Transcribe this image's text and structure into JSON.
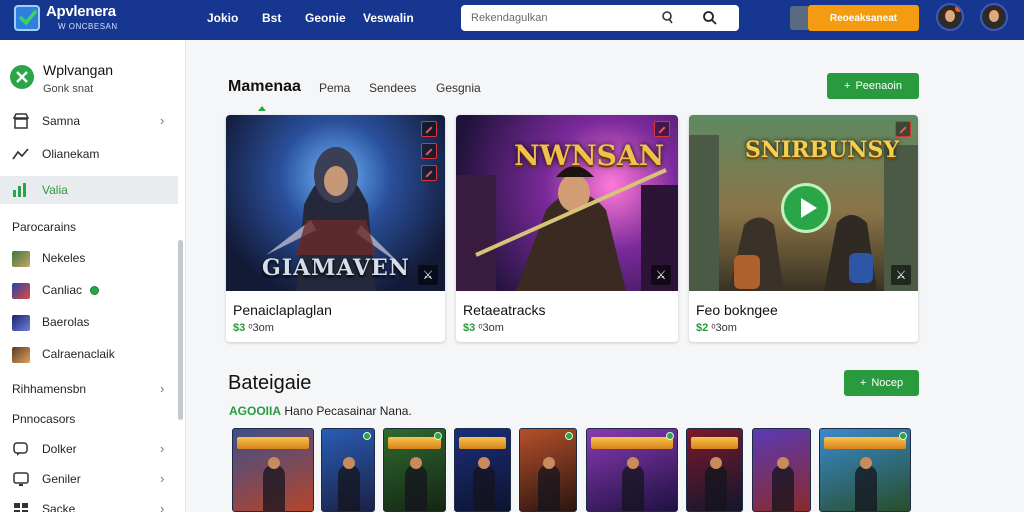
{
  "app": {
    "brand_title": "Apvlenera",
    "brand_sub": "W ONCBESAN"
  },
  "topbar": {
    "nav": [
      "Jokio",
      "Bst",
      "Geonie",
      "Veswalin"
    ],
    "search_placeholder": "Rekendagulkan",
    "cta_label": "Reoeaksaneat"
  },
  "sidebar": {
    "profile_name": "Wplvangan",
    "profile_sub": "Gonk snat",
    "nav_items": [
      {
        "label": "Samna",
        "icon": "store-icon",
        "chevron": "›"
      },
      {
        "label": "Olianekam",
        "icon": "trending-icon"
      },
      {
        "label": "Valia",
        "icon": "chart-icon",
        "active": true
      }
    ],
    "section1_heading": "Parocarains",
    "section1_items": [
      {
        "label": "Nekeles"
      },
      {
        "label": "Canliac",
        "badge": true
      },
      {
        "label": "Baerolas"
      },
      {
        "label": "Calraenaclaik"
      }
    ],
    "more_link": "Rihhamensbn",
    "more_chevron": "›",
    "section2_heading": "Pnnocasors",
    "section2_items": [
      {
        "label": "Dolker",
        "icon": "chat-icon",
        "chevron": "›"
      },
      {
        "label": "Geniler",
        "icon": "monitor-icon",
        "chevron": "›"
      },
      {
        "label": "Sacke",
        "icon": "grid-icon",
        "chevron": "›"
      }
    ]
  },
  "main": {
    "section_title": "Mamenaa",
    "tabs": [
      "Pema",
      "Sendees",
      "Gesgnia"
    ],
    "add_button_label": "Peenaoin",
    "add_button_icon": "+",
    "cards": [
      {
        "title": "Penaiclaplaglan",
        "price": "$3",
        "price_note": "ᵒ3om",
        "art_text": "GIAMAVEN"
      },
      {
        "title": "Retaeatracks",
        "price": "$3",
        "price_note": "ᵒ3om",
        "art_text": "NWNSAN"
      },
      {
        "title": "Feo bokngee",
        "price": "$2",
        "price_note": "ᵒ3om",
        "art_text": "SNIRBUNSY"
      }
    ],
    "section2_title": "Bateigaie",
    "section2_button_label": "Nocep",
    "section2_button_icon": "+",
    "featured_highlight": "AGOOIIA",
    "featured_line": "Hano Pecasainar Nana.",
    "thumb_count": 9
  },
  "colors": {
    "topbar": "#16368f",
    "accent_green": "#2a9a3e",
    "cta_orange": "#f39c11"
  }
}
